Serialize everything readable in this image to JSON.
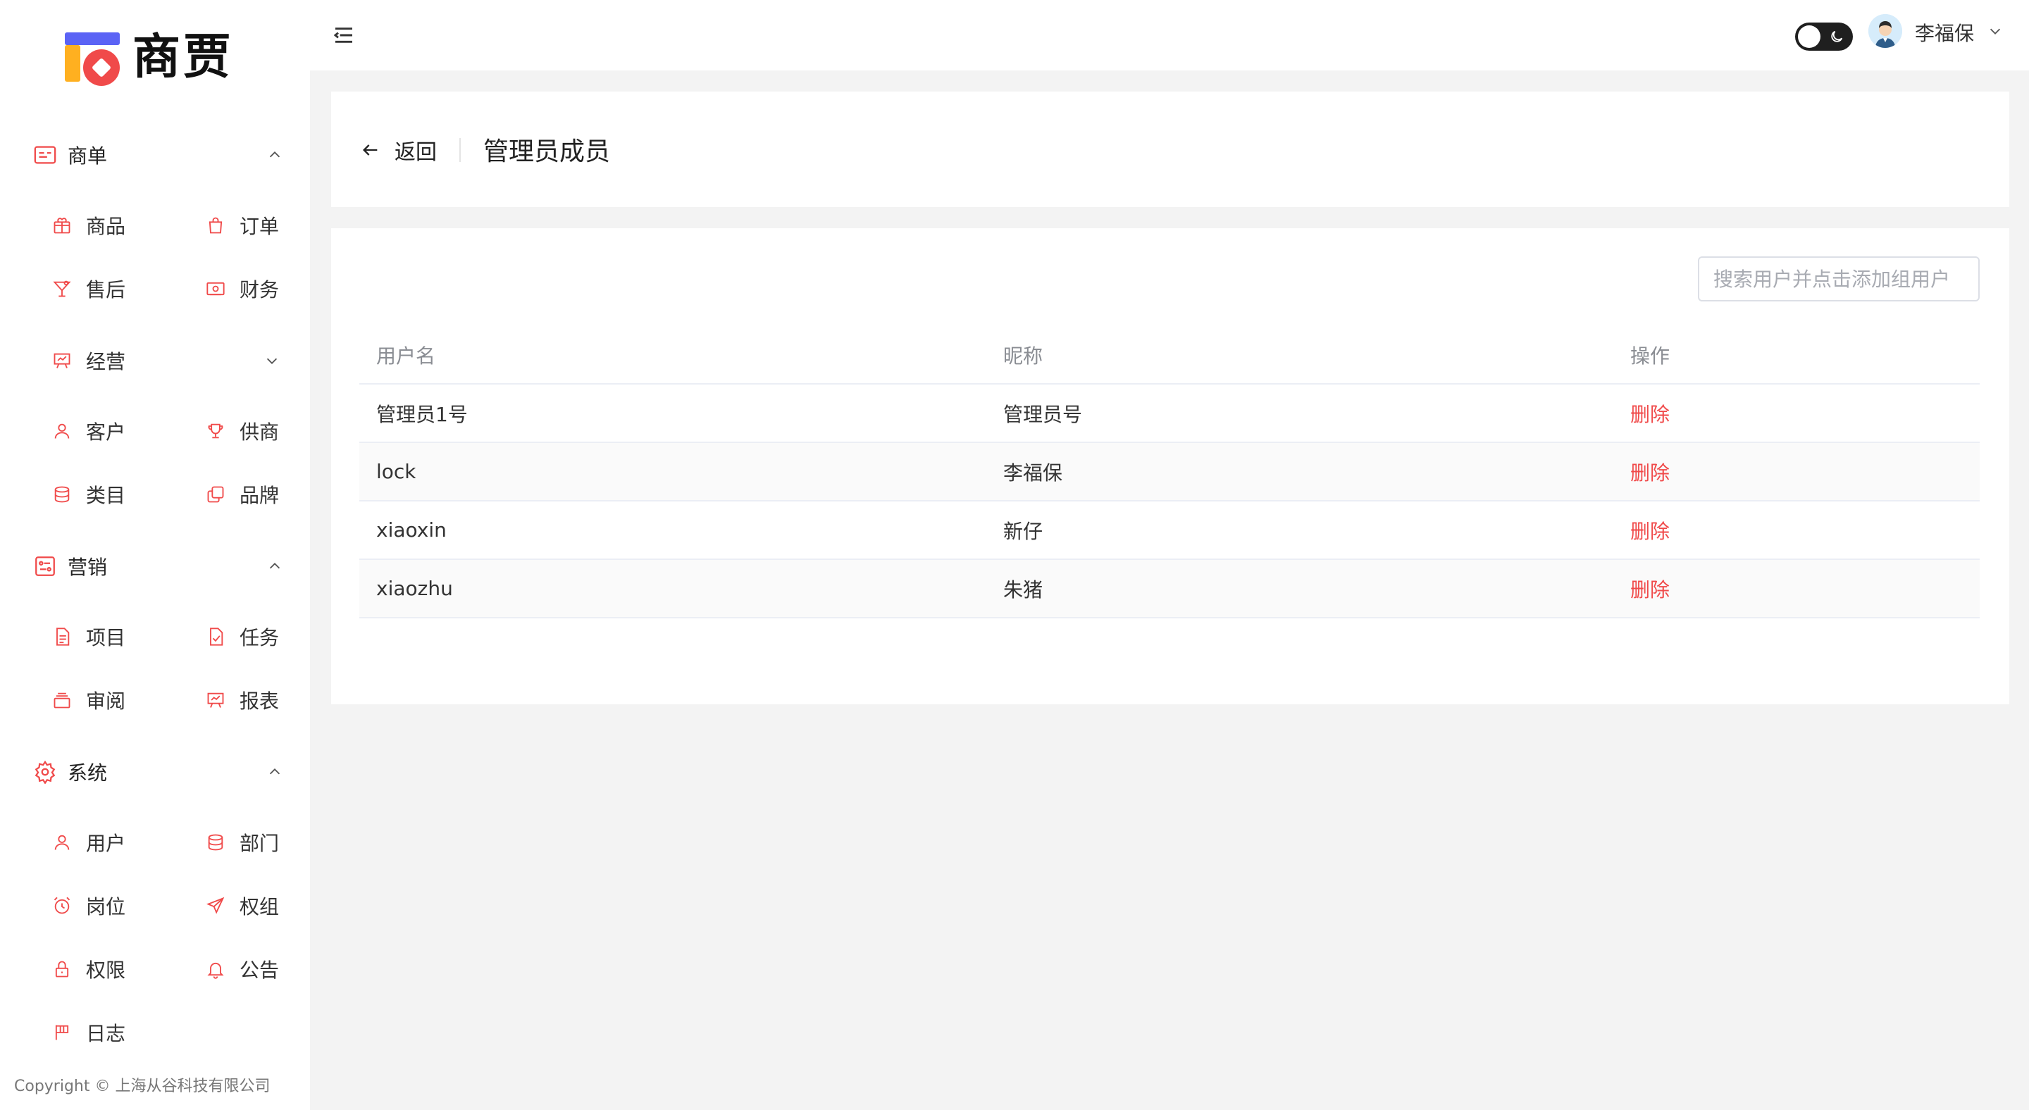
{
  "app": {
    "logo_text": "商贾",
    "copyright": "Copyright © 上海从谷科技有限公司"
  },
  "colors": {
    "accent": "#f04a4a",
    "logo_blue": "#5b63f5",
    "logo_orange": "#ffb020",
    "toggle_bg": "#1f1f1f"
  },
  "sidebar": {
    "sections": [
      {
        "label": "商单",
        "icon": "shop-card-icon",
        "expanded": true
      },
      {
        "label": "营销",
        "icon": "marketing-panel-icon",
        "expanded": true
      },
      {
        "label": "系统",
        "icon": "gear-icon",
        "expanded": true
      }
    ],
    "items": {
      "goods": {
        "label": "商品",
        "icon": "gift-box-icon"
      },
      "orders": {
        "label": "订单",
        "icon": "shopping-bag-icon"
      },
      "after_sales": {
        "label": "售后",
        "icon": "cocktail-icon"
      },
      "finance": {
        "label": "财务",
        "icon": "money-icon"
      },
      "operations": {
        "label": "经营",
        "icon": "presentation-board-icon",
        "collapsed": true
      },
      "customers": {
        "label": "客户",
        "icon": "user-icon"
      },
      "suppliers": {
        "label": "供商",
        "icon": "trophy-icon"
      },
      "categories": {
        "label": "类目",
        "icon": "database-icon"
      },
      "brands": {
        "label": "品牌",
        "icon": "copy-icon"
      },
      "projects": {
        "label": "项目",
        "icon": "document-icon"
      },
      "tasks": {
        "label": "任务",
        "icon": "document-check-icon"
      },
      "review": {
        "label": "审阅",
        "icon": "tray-icon"
      },
      "reports": {
        "label": "报表",
        "icon": "presentation-board-icon"
      },
      "users": {
        "label": "用户",
        "icon": "user-icon"
      },
      "departments": {
        "label": "部门",
        "icon": "database-icon"
      },
      "positions": {
        "label": "岗位",
        "icon": "alarm-clock-icon"
      },
      "permission_groups": {
        "label": "权组",
        "icon": "send-icon"
      },
      "permissions": {
        "label": "权限",
        "icon": "lock-icon"
      },
      "announcements": {
        "label": "公告",
        "icon": "bell-icon"
      },
      "logs": {
        "label": "日志",
        "icon": "flag-icon"
      }
    }
  },
  "header": {
    "user_name": "李福保",
    "theme": "dark-toggle"
  },
  "page": {
    "back_label": "返回",
    "title": "管理员成员"
  },
  "search": {
    "placeholder": "搜索用户并点击添加组用户",
    "value": ""
  },
  "table": {
    "columns": [
      "用户名",
      "昵称",
      "操作"
    ],
    "rows": [
      {
        "username": "管理员1号",
        "nickname": "管理员号",
        "action": "删除"
      },
      {
        "username": "lock",
        "nickname": "李福保",
        "action": "删除"
      },
      {
        "username": "xiaoxin",
        "nickname": "新仔",
        "action": "删除"
      },
      {
        "username": "xiaozhu",
        "nickname": "朱猪",
        "action": "删除"
      }
    ]
  }
}
